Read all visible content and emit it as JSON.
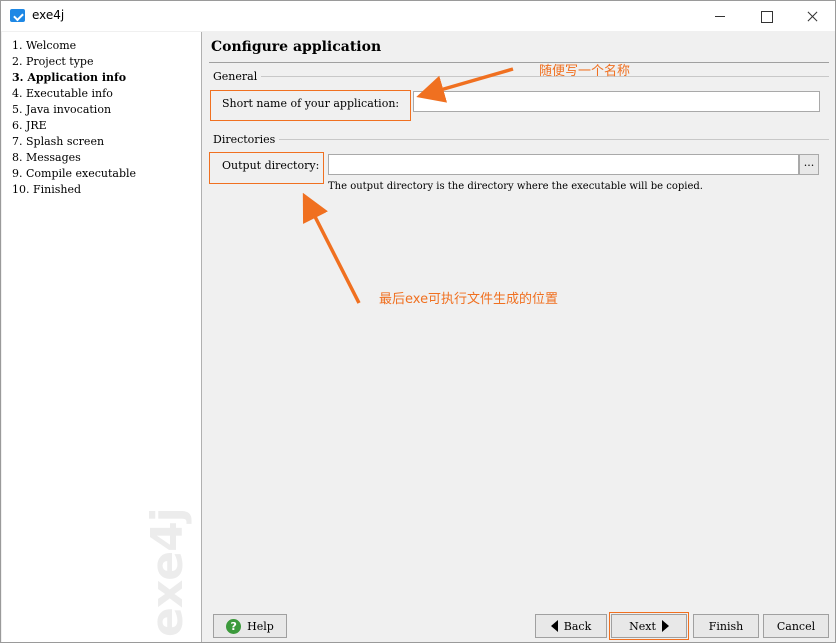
{
  "window": {
    "title": "exe4j",
    "app_icon": "exe4j-app-icon",
    "controls": [
      "minimize-icon",
      "maximize-icon",
      "close-icon"
    ]
  },
  "sidebar": {
    "steps": [
      {
        "label": "1.  Welcome",
        "active": false
      },
      {
        "label": "2.  Project type",
        "active": false
      },
      {
        "label": "3.  Application info",
        "active": true
      },
      {
        "label": "4.  Executable info",
        "active": false
      },
      {
        "label": "5.  Java invocation",
        "active": false
      },
      {
        "label": "6.  JRE",
        "active": false
      },
      {
        "label": "7.  Splash screen",
        "active": false
      },
      {
        "label": "8.  Messages",
        "active": false
      },
      {
        "label": "9.  Compile executable",
        "active": false
      },
      {
        "label": "10.  Finished",
        "active": false
      }
    ],
    "watermark": "exe4j"
  },
  "main": {
    "title": "Configure application",
    "general": {
      "section_label": "General",
      "short_name_label": "Short name of your application:",
      "short_name_value": ""
    },
    "directories": {
      "section_label": "Directories",
      "output_dir_label": "Output directory:",
      "output_dir_value": "",
      "browse_label": "...",
      "hint": "The output directory is the directory where the executable will be copied."
    }
  },
  "buttons": {
    "help": "Help",
    "back": "Back",
    "next": "Next",
    "finish": "Finish",
    "cancel": "Cancel"
  },
  "annotations": {
    "name_note": "随便写一个名称",
    "output_note": "最后exe可执行文件生成的位置",
    "color": "#f07020"
  }
}
